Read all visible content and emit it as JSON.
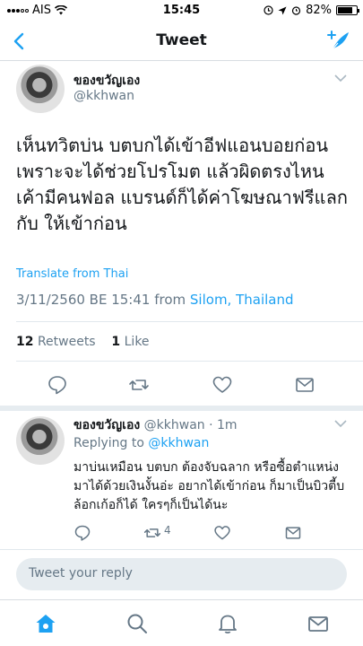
{
  "status_bar": {
    "carrier": "AIS",
    "time": "15:45",
    "battery": "82%",
    "battery_level": 0.82
  },
  "nav": {
    "title": "Tweet"
  },
  "tweet": {
    "author_name": "ของขวัญเอง",
    "author_handle": "@kkhwan",
    "text": "เห็นทวิตบ่น บตบกได้เข้าอีฟแอนบอยก่อน เพราะจะได้ช่วยโปรโมต แล้วผิดตรงไหน เค้ามีคนฟอล แบรนด์ก็ได้ค่าโฆษณาฟรีแลกกับ ให้เข้าก่อน",
    "translate_label": "Translate from Thai",
    "timestamp": "3/11/2560 BE 15:41 from",
    "location": "Silom, Thailand",
    "retweets_count": "12",
    "retweets_label": "Retweets",
    "likes_count": "1",
    "likes_label": "Like"
  },
  "reply": {
    "author_name": "ของขวัญเอง",
    "author_handle": "@kkhwan",
    "time": "· 1m",
    "replying_label": "Replying to",
    "replying_to": "@kkhwan",
    "text": "มาบ่นเหมือน บตบก ต้องจับฉลาก หรือซื้อตำแหน่งมาได้ด้วยเงินงั้นอ่ะ อยากได้เข้าก่อน ก็มาเป็นบิวตี้บล้อกเก้อก็ได้ ใครๆก็เป็นได้นะ",
    "retweet_count": "4"
  },
  "reply_box": {
    "placeholder": "Tweet your reply"
  },
  "colors": {
    "accent": "#1da1f2",
    "secondary_text": "#657786",
    "divider": "#e1e8ed"
  }
}
